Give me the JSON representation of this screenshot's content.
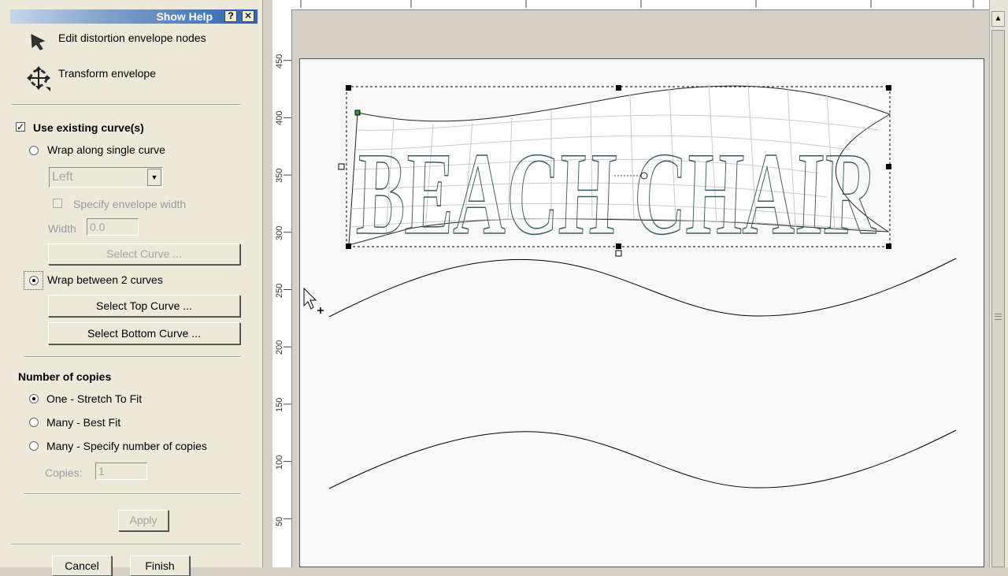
{
  "panel": {
    "title": "Show Help",
    "help_button": "?",
    "close_button": "✕",
    "tools": [
      {
        "label": "Edit distortion envelope nodes",
        "icon": "node-edit-arrow-icon"
      },
      {
        "label": "Transform envelope",
        "icon": "transform-move-icon"
      }
    ],
    "use_existing": {
      "label": "Use existing curve(s)",
      "checked": true
    },
    "wrap_single": {
      "label": "Wrap along single curve",
      "selected": false
    },
    "align_select": {
      "value": "Left"
    },
    "specify_width": {
      "label": "Specify envelope width",
      "checked": false
    },
    "width": {
      "label": "Width",
      "value": "0.0"
    },
    "select_curve_button": "Select Curve ...",
    "wrap_two": {
      "label": "Wrap between 2 curves",
      "selected": true
    },
    "select_top_button": "Select Top Curve ...",
    "select_bottom_button": "Select Bottom Curve ...",
    "copies_section": {
      "title": "Number of copies",
      "options": [
        {
          "label": "One - Stretch To Fit",
          "selected": true
        },
        {
          "label": "Many - Best Fit",
          "selected": false
        },
        {
          "label": "Many - Specify number of copies",
          "selected": false
        }
      ],
      "copies_label": "Copies:",
      "copies_value": "1"
    },
    "apply_button": "Apply",
    "cancel_button": "Cancel",
    "finish_button": "Finish"
  },
  "ruler": {
    "vertical_labels": [
      "450",
      "400",
      "350",
      "300",
      "250",
      "200",
      "150",
      "100",
      "50"
    ],
    "vertical_values": [
      450,
      400,
      350,
      300,
      250,
      200,
      150,
      100,
      50
    ]
  },
  "canvas": {
    "wrapped_text": "BEACH CHAIR",
    "colors": {
      "text_outline": "#3a5a5a",
      "selection_handle": "#000000",
      "start_node": "#2f9e2f",
      "curve": "#000000",
      "page": "#f8f8f8"
    }
  }
}
